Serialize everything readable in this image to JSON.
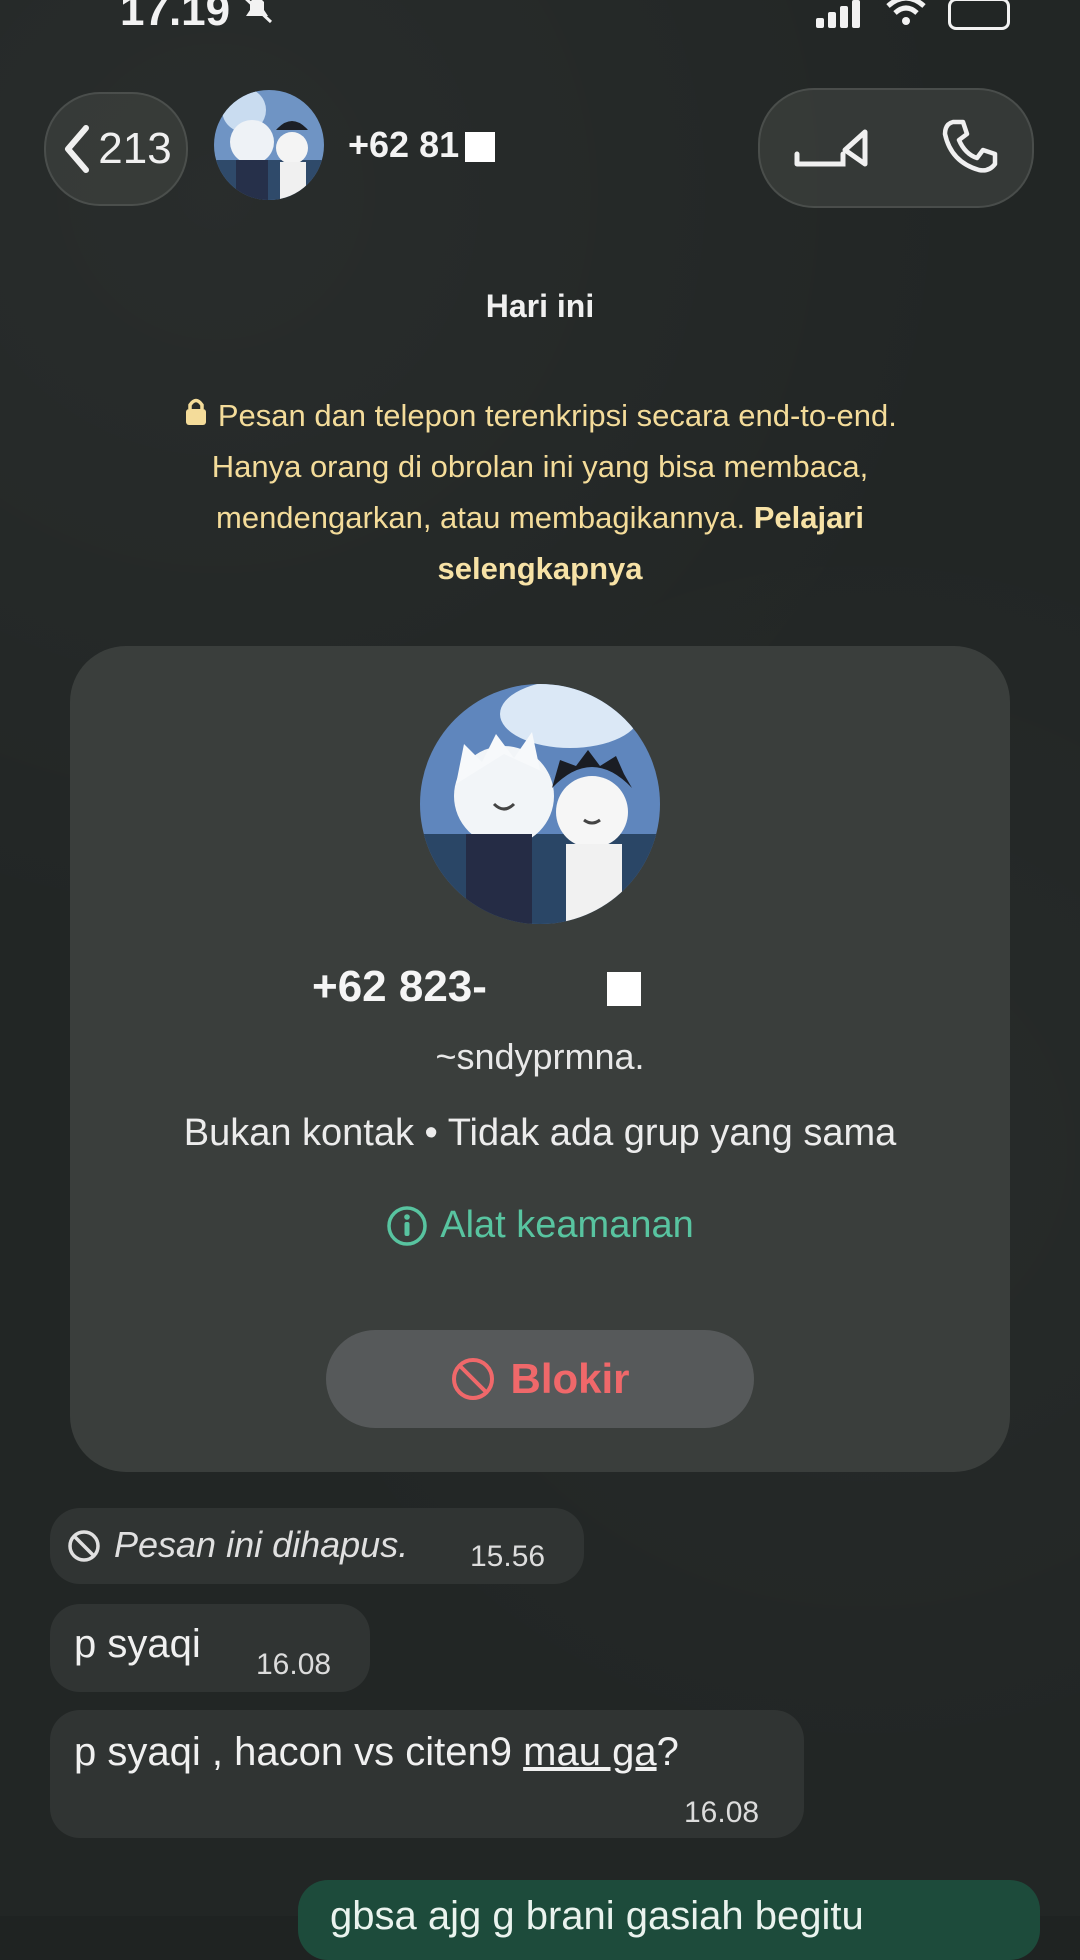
{
  "status_bar": {
    "time": "17.19"
  },
  "header": {
    "back_count": "213",
    "contact_name": "+62 81"
  },
  "date_label": "Hari ini",
  "encryption_notice": {
    "text": "Pesan dan telepon terenkripsi secara end-to-end. Hanya orang di obrolan ini yang bisa membaca, mendengarkan, atau membagikannya.",
    "link": "Pelajari selengkapnya"
  },
  "profile_card": {
    "phone": "+62 823-",
    "username": "~sndyprmna.",
    "meta": "Bukan kontak • Tidak ada grup yang sama",
    "security_link": "Alat keamanan",
    "block_label": "Blokir"
  },
  "messages": [
    {
      "text": "Pesan ini dihapus.",
      "time": "15.56",
      "deleted": true
    },
    {
      "text": "p syaqi",
      "time": "16.08"
    },
    {
      "text_prefix": "p syaqi , hacon vs citen9 ",
      "text_underlined": "mau ga",
      "text_suffix": "?",
      "time": "16.08"
    }
  ],
  "outgoing_partial": {
    "text": "gbsa ajg g brani gasiah begitu"
  },
  "colors": {
    "accent_green": "#58c4a0",
    "block_red": "#f0686a",
    "notice_yellow": "#f4dc9a"
  }
}
